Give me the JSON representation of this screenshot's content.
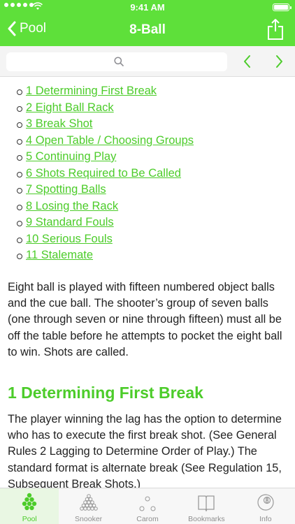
{
  "status": {
    "time": "9:41 AM"
  },
  "nav": {
    "back_label": "Pool",
    "title": "8-Ball"
  },
  "search": {
    "value": "",
    "placeholder": ""
  },
  "toc": [
    "1 Determining First Break",
    "2 Eight Ball Rack",
    "3 Break Shot",
    "4 Open Table / Choosing Groups",
    "5 Continuing Play",
    "6 Shots Required to Be Called",
    "7 Spotting Balls",
    "8 Losing the Rack",
    "9 Standard Fouls",
    "10 Serious Fouls",
    "11 Stalemate"
  ],
  "intro": "Eight ball is played with fifteen numbered object balls and the cue ball. The shooter’s group of seven balls (one through seven or nine through fifteen) must all be off the table before he attempts to pocket the eight ball to win. Shots are called.",
  "section1": {
    "heading": "1 Determining First Break",
    "body": "The player winning the lag has the option to determine who has to execute the first break shot. (See General Rules 2 Lagging to Determine Order of Play.) The standard format is alternate break (See Regulation 15, Subsequent Break Shots.)"
  },
  "tabs": [
    {
      "label": "Pool",
      "icon": "pool-rack-icon",
      "active": true
    },
    {
      "label": "Snooker",
      "icon": "snooker-rack-icon",
      "active": false
    },
    {
      "label": "Carom",
      "icon": "carom-balls-icon",
      "active": false
    },
    {
      "label": "Bookmarks",
      "icon": "book-icon",
      "active": false
    },
    {
      "label": "Info",
      "icon": "eight-ball-icon",
      "active": false
    }
  ],
  "colors": {
    "accent": "#5ee03a",
    "link": "#4ccc2a",
    "text": "#222222"
  }
}
